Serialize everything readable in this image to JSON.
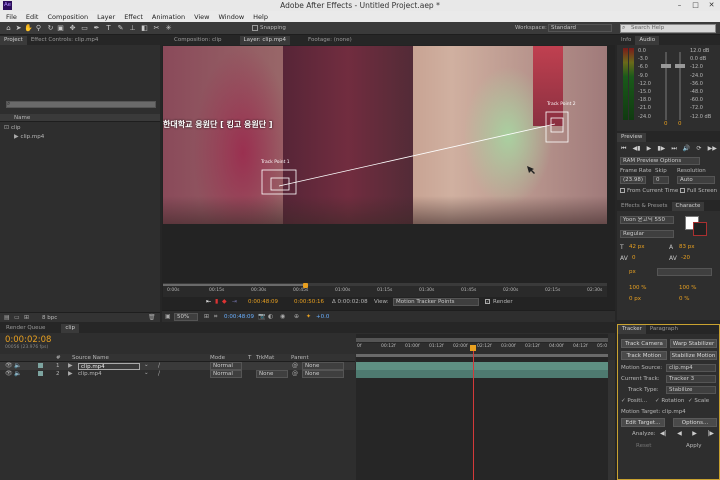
{
  "app": {
    "title": "Adobe After Effects - Untitled Project.aep *",
    "logo": "Ae"
  },
  "menu": [
    "File",
    "Edit",
    "Composition",
    "Layer",
    "Effect",
    "Animation",
    "View",
    "Window",
    "Help"
  ],
  "toolbar": {
    "snapping_label": "Snapping",
    "workspace_label": "Workspace:",
    "workspace_value": "Standard",
    "search_placeholder": "Search Help"
  },
  "project_panel": {
    "tabs": [
      "Project",
      "Effect Controls: clip.mp4"
    ],
    "column_name": "Name",
    "items": [
      {
        "name": "clip",
        "type": "composition"
      },
      {
        "name": "clip.mp4",
        "type": "footage"
      }
    ],
    "bpc": "8 bpc"
  },
  "viewer": {
    "tabs": [
      "Composition: clip",
      "Layer: clip.mp4",
      "Footage: (none)"
    ],
    "overlay_text": "한대학교 응원단 [ 킹고 응원단 ]",
    "track_point_1": "Track Point 1",
    "track_point_2": "Track Point 2",
    "ruler_labels": [
      "0:00s",
      "00:15s",
      "00:30s",
      "00:45s",
      "01:00s",
      "01:15s",
      "01:30s",
      "01:45s",
      "02:00s",
      "02:15s",
      "02:30s"
    ],
    "current_time": "0:00:48:09",
    "end_time": "0:00:50:16",
    "duration": "Δ 0:00:02:08",
    "view_label": "View:",
    "view_value": "Motion Tracker Points",
    "render_label": "Render",
    "zoom": "50%",
    "bottom_time": "0:00:48:09",
    "offset": "+0.0"
  },
  "info_panel": {
    "tabs": [
      "Info",
      "Audio"
    ],
    "db_left": [
      "0.0",
      "-3.0",
      "-6.0",
      "-9.0",
      "-12.0",
      "-15.0",
      "-18.0",
      "-21.0",
      "-24.0"
    ],
    "db_right": [
      "12.0 dB",
      "0.0 dB",
      "-12.0",
      "-24.0",
      "-36.0",
      "-48.0",
      "-60.0",
      "-72.0",
      "-12.0 dB"
    ],
    "levels": [
      "0",
      "0"
    ]
  },
  "preview_panel": {
    "title": "Preview",
    "ram_options": "RAM Preview Options",
    "frame_rate_label": "Frame Rate",
    "skip_label": "Skip",
    "resolution_label": "Resolution",
    "frame_rate_value": "(23.98)",
    "skip_value": "0",
    "resolution_value": "Auto",
    "from_current_label": "From Current Time",
    "full_screen_label": "Full Screen"
  },
  "effects_panel": {
    "tabs": [
      "Effects & Presets",
      "Characte"
    ],
    "font": "Yoon 윤고딕 550",
    "style": "Regular",
    "size": "42 px",
    "leading": "83 px",
    "kerning": "0",
    "tracking": "-20",
    "unit": "px",
    "vscale": "100 %",
    "hscale": "100 %",
    "baseline": "0 px",
    "tsume": "0 %"
  },
  "tracker_panel": {
    "tabs": [
      "Tracker",
      "Paragraph"
    ],
    "track_camera": "Track Camera",
    "warp_stabilizer": "Warp Stabilizer",
    "track_motion": "Track Motion",
    "stabilize_motion": "Stabilize Motion",
    "motion_source_label": "Motion Source:",
    "motion_source_value": "clip.mp4",
    "current_track_label": "Current Track:",
    "current_track_value": "Tracker 3",
    "track_type_label": "Track Type:",
    "track_type_value": "Stabilize",
    "position_label": "Positi...",
    "rotation_label": "Rotation",
    "scale_label": "Scale",
    "motion_target": "Motion Target: clip.mp4",
    "edit_target": "Edit Target...",
    "options": "Options...",
    "analyze_label": "Analyze:",
    "reset": "Reset",
    "apply": "Apply"
  },
  "timeline": {
    "tabs": [
      "Render Queue",
      "clip"
    ],
    "current_time": "0:00:02:08",
    "frame_info": "00056 (23.976 fps)",
    "columns": {
      "num": "#",
      "source": "Source Name",
      "mode": "Mode",
      "t": "T",
      "trkmat": "TrkMat",
      "parent": "Parent"
    },
    "layers": [
      {
        "num": "1",
        "name": "clip.mp4",
        "mode": "Normal",
        "trkmat": "",
        "parent": "None"
      },
      {
        "num": "2",
        "name": "clip.mp4",
        "mode": "Normal",
        "trkmat": "None",
        "parent": "None"
      }
    ],
    "ruler": [
      "0f",
      "00:12f",
      "01:00f",
      "01:12f",
      "02:00f",
      "02:12f",
      "03:00f",
      "03:12f",
      "04:00f",
      "04:12f",
      "05:0"
    ]
  },
  "colors": {
    "accent": "#e8a020",
    "timeline_bar": "#5e8f82",
    "cti": "#d43a3a"
  }
}
